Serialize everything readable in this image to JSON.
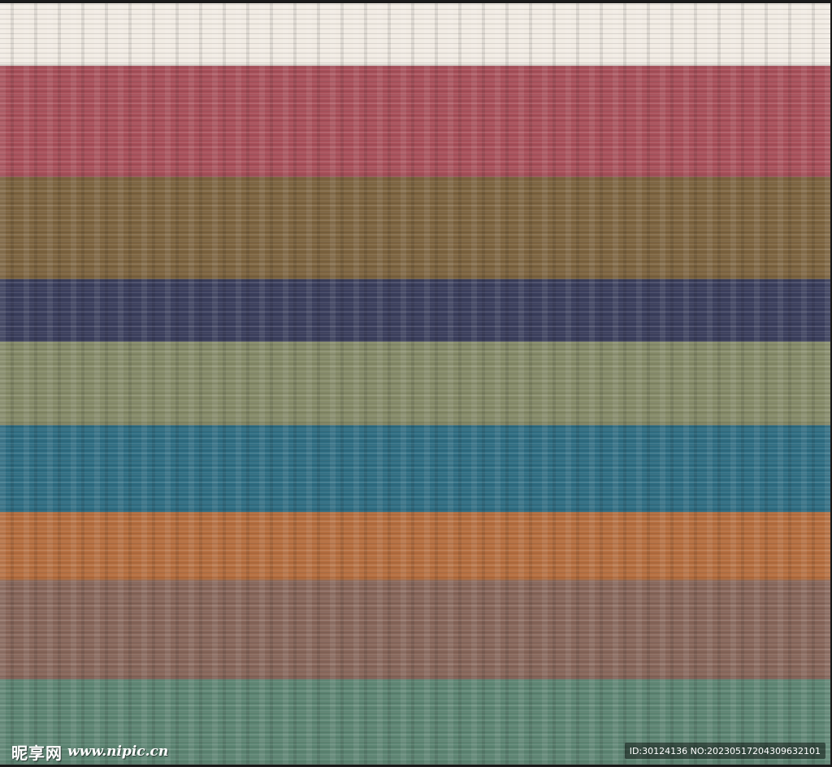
{
  "image": {
    "stripes": [
      {
        "name": "cream",
        "color": "#f1ebe3"
      },
      {
        "name": "brick-red",
        "color": "#a8505a"
      },
      {
        "name": "olive-brown",
        "color": "#7d6440"
      },
      {
        "name": "navy",
        "color": "#3b3f5d"
      },
      {
        "name": "sage-green",
        "color": "#858a68"
      },
      {
        "name": "teal-blue",
        "color": "#2f6d82"
      },
      {
        "name": "burnt-orange",
        "color": "#b56e3f"
      },
      {
        "name": "mocha",
        "color": "#87665a"
      },
      {
        "name": "jade-green",
        "color": "#5d8573"
      }
    ]
  },
  "watermark": {
    "site_name": "昵享网",
    "site_url": "www.nipic.cn",
    "id_text": "ID:30124136 NO:20230517204309632101"
  }
}
